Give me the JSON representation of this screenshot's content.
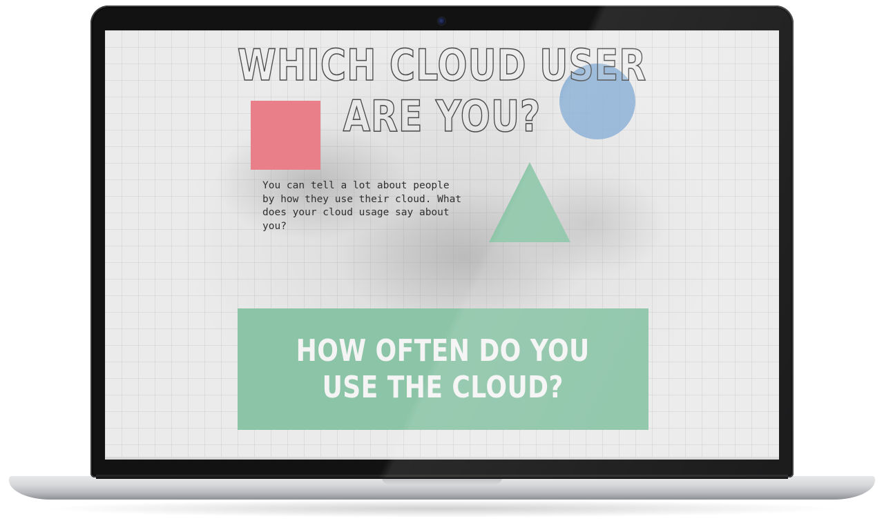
{
  "page": {
    "title_line1": "WHICH CLOUD USER",
    "title_line2": "ARE YOU?",
    "intro": "You can tell a lot about people by how they use their cloud. What does your cloud usage say about you?",
    "question_line1": "HOW OFTEN DO YOU",
    "question_line2": "USE THE CLOUD?"
  },
  "shapes": {
    "square_color": "#e97f89",
    "circle_color": "#82aad2",
    "triangle_color": "#8cc4a7",
    "cta_color": "#8cc4a7"
  },
  "icons": {
    "camera": "webcam-icon"
  }
}
